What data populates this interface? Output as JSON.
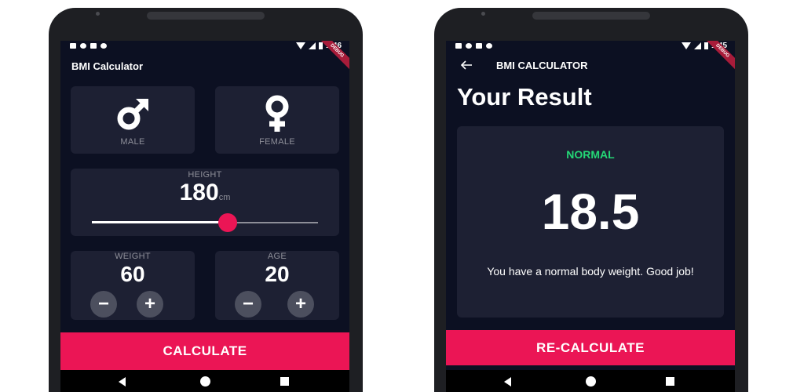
{
  "status": {
    "time_left": "1:46",
    "time_right": "1:45",
    "ribbon": "DEBUG"
  },
  "input_screen": {
    "title": "BMI Calculator",
    "gender": {
      "male_label": "MALE",
      "female_label": "FEMALE",
      "male_icon": "mars-icon",
      "female_icon": "venus-icon"
    },
    "height": {
      "label": "HEIGHT",
      "value": "180",
      "unit": "cm",
      "slider_fraction": 0.6
    },
    "weight": {
      "label": "WEIGHT",
      "value": "60",
      "minus": "−",
      "plus": "+"
    },
    "age": {
      "label": "AGE",
      "value": "20",
      "minus": "−",
      "plus": "+"
    },
    "button": "CALCULATE"
  },
  "result_screen": {
    "title": "BMI CALCULATOR",
    "back_icon": "arrow-left-icon",
    "heading": "Your Result",
    "status": "NORMAL",
    "bmi": "18.5",
    "message": "You have a normal body weight. Good job!",
    "button": "RE-CALCULATE"
  },
  "colors": {
    "background": "#0c1022",
    "card": "#1d2033",
    "accent": "#eb1555",
    "normal": "#24d876",
    "label": "#8d8e98"
  }
}
